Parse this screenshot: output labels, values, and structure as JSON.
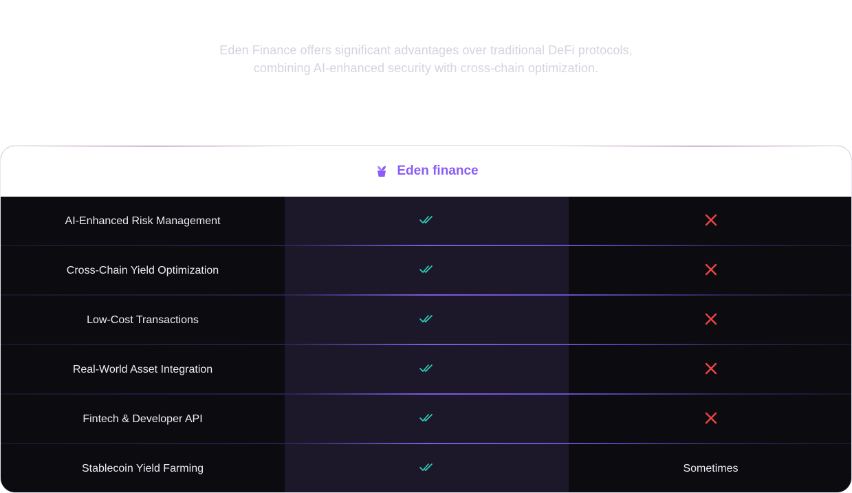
{
  "intro": {
    "line1": "Eden Finance offers significant advantages over traditional DeFi protocols,",
    "line2": "combining AI-enhanced security with cross-chain optimization."
  },
  "table": {
    "brand_label": "Eden finance",
    "brand_icon": "plant-pot-icon",
    "colors": {
      "brand": "#8b5cf6",
      "check": "#2dd4bf",
      "cross": "#ef4444"
    },
    "rows": [
      {
        "feature": "AI-Enhanced Risk Management",
        "eden": "check",
        "other": "cross",
        "other_text": ""
      },
      {
        "feature": "Cross-Chain Yield Optimization",
        "eden": "check",
        "other": "cross",
        "other_text": ""
      },
      {
        "feature": "Low-Cost Transactions",
        "eden": "check",
        "other": "cross",
        "other_text": ""
      },
      {
        "feature": "Real-World Asset Integration",
        "eden": "check",
        "other": "cross",
        "other_text": ""
      },
      {
        "feature": "Fintech & Developer API",
        "eden": "check",
        "other": "cross",
        "other_text": ""
      },
      {
        "feature": "Stablecoin Yield Farming",
        "eden": "check",
        "other": "text",
        "other_text": "Sometimes"
      }
    ]
  }
}
